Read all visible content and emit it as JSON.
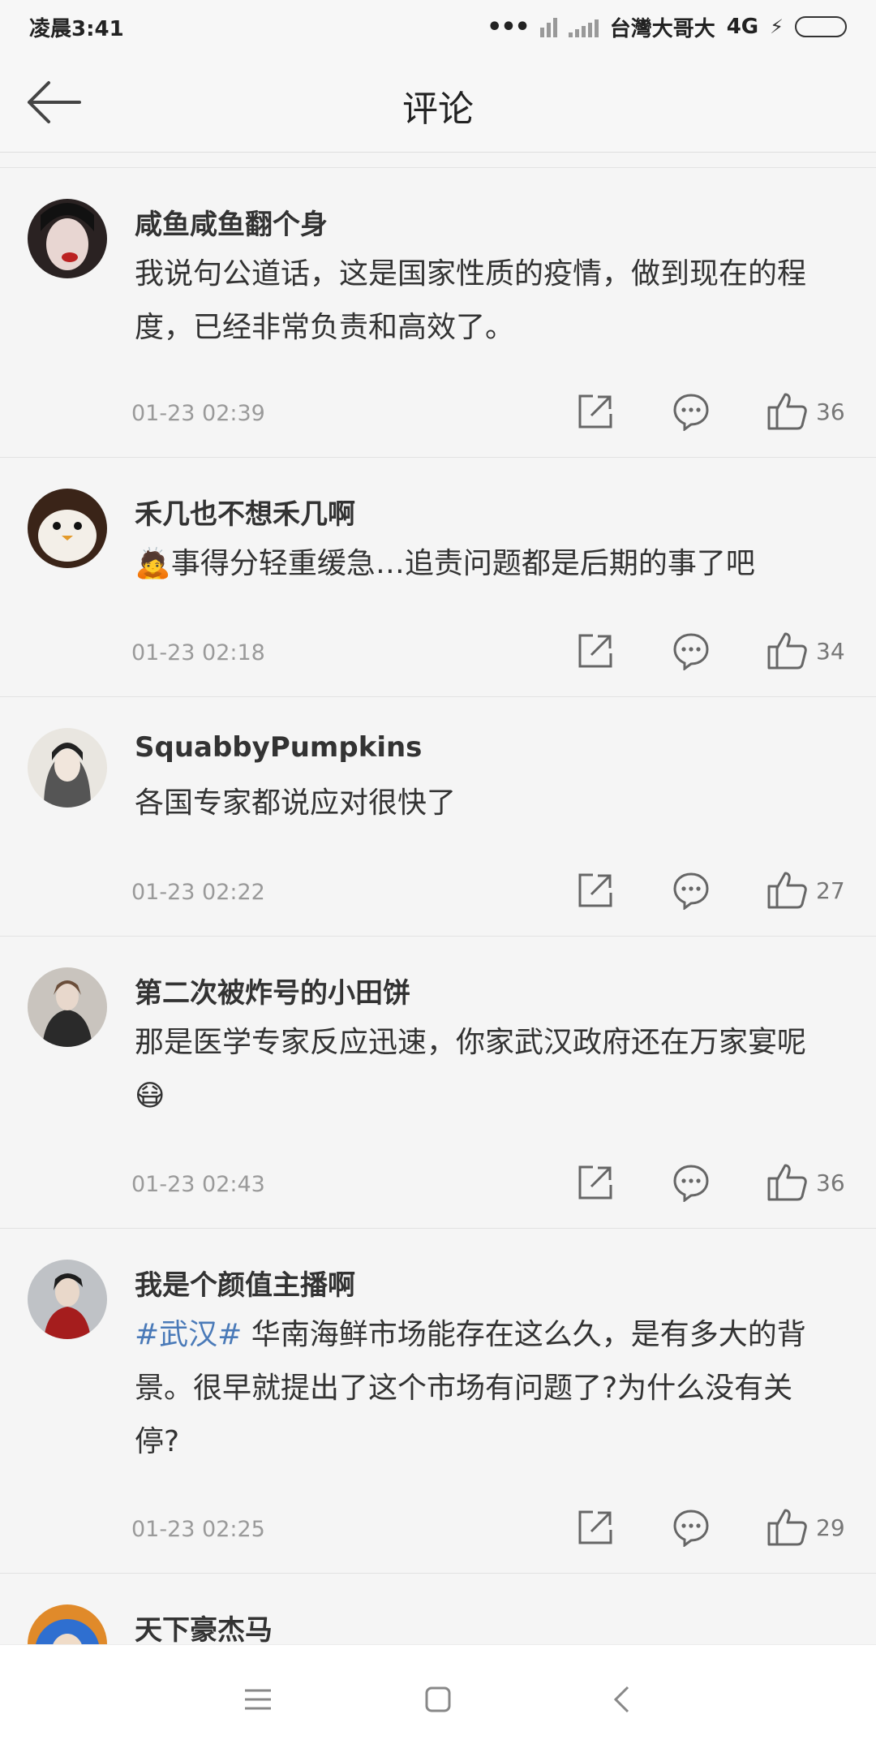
{
  "status_bar": {
    "time": "凌晨3:41",
    "carrier": "台灣大哥大",
    "network": "4G"
  },
  "header": {
    "title": "评论"
  },
  "comments": [
    {
      "user": "咸鱼咸鱼翻个身",
      "text": "我说句公道话，这是国家性质的疫情，做到现在的程度，已经非常负责和高效了。",
      "time": "01-23 02:39",
      "likes": "36"
    },
    {
      "user": "禾几也不想禾几啊",
      "emoji": "🙇",
      "text": "事得分轻重缓急…追责问题都是后期的事了吧",
      "time": "01-23 02:18",
      "likes": "34"
    },
    {
      "user": "SquabbyPumpkins",
      "text": "各国专家都说应对很快了",
      "time": "01-23 02:22",
      "likes": "27"
    },
    {
      "user": "第二次被炸号的小田饼",
      "text": "那是医学专家反应迅速，你家武汉政府还在万家宴呢",
      "emoji": "😷",
      "time": "01-23 02:43",
      "likes": "36"
    },
    {
      "user": "我是个颜值主播啊",
      "hashtag": "#武汉#",
      "text": " 华南海鲜市场能存在这么久，是有多大的背景。很早就提出了这个市场有问题了?为什么没有关停?",
      "time": "01-23 02:25",
      "likes": "29"
    },
    {
      "user": "天下豪杰马"
    }
  ],
  "icons": {
    "back": "arrow-left-icon",
    "share": "share-icon",
    "reply": "comment-bubble-icon",
    "like": "thumbs-up-icon",
    "nav_menu": "menu-icon",
    "nav_home": "home-square-icon",
    "nav_back": "chevron-left-icon"
  },
  "colors": {
    "hashtag": "#4a7ab8",
    "meta": "#9a9a9a",
    "background": "#f5f5f5"
  }
}
